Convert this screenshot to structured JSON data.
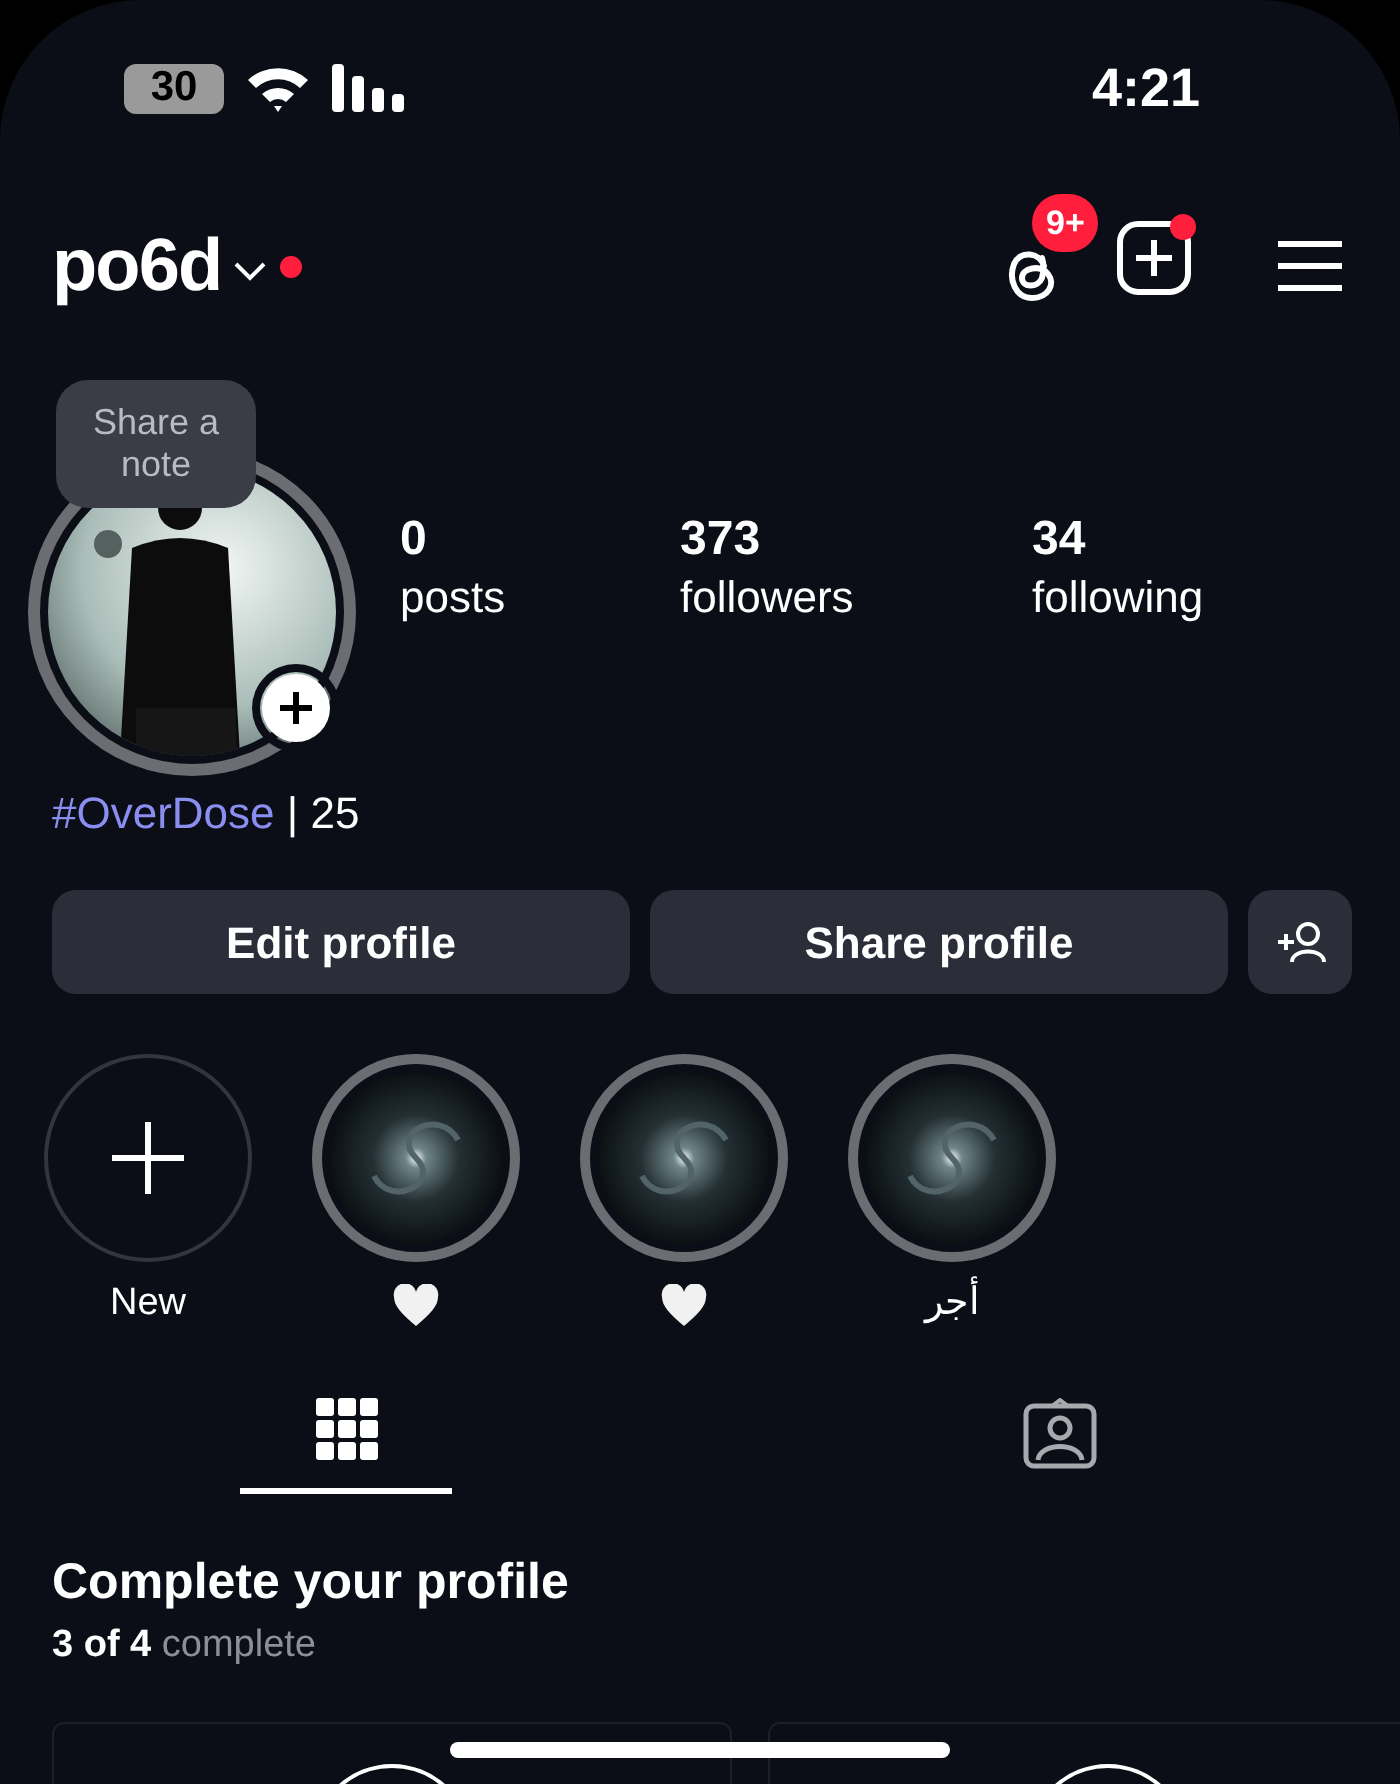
{
  "status_bar": {
    "battery": "30",
    "time": "4:21"
  },
  "header": {
    "username": "po6d",
    "live_dot": true,
    "threads_badge": "9+",
    "create_dot": true
  },
  "note_bubble": "Share a note",
  "stats": [
    {
      "value": "0",
      "label": "posts"
    },
    {
      "value": "373",
      "label": "followers"
    },
    {
      "value": "34",
      "label": "following"
    }
  ],
  "bio": {
    "hashtag": "#OverDose",
    "text": "| 25"
  },
  "buttons": [
    "Edit profile",
    "Share profile"
  ],
  "highlights": [
    {
      "kind": "new",
      "label": "New"
    },
    {
      "kind": "heart"
    },
    {
      "kind": "heart"
    },
    {
      "kind": "text",
      "label": "أجر"
    }
  ],
  "tabs": [
    {
      "kind": "grid",
      "selected": true
    },
    {
      "kind": "tagged",
      "selected": false
    }
  ],
  "complete_profile": {
    "title": "Complete your profile",
    "progress": "3 of 4",
    "suffix": "complete"
  }
}
